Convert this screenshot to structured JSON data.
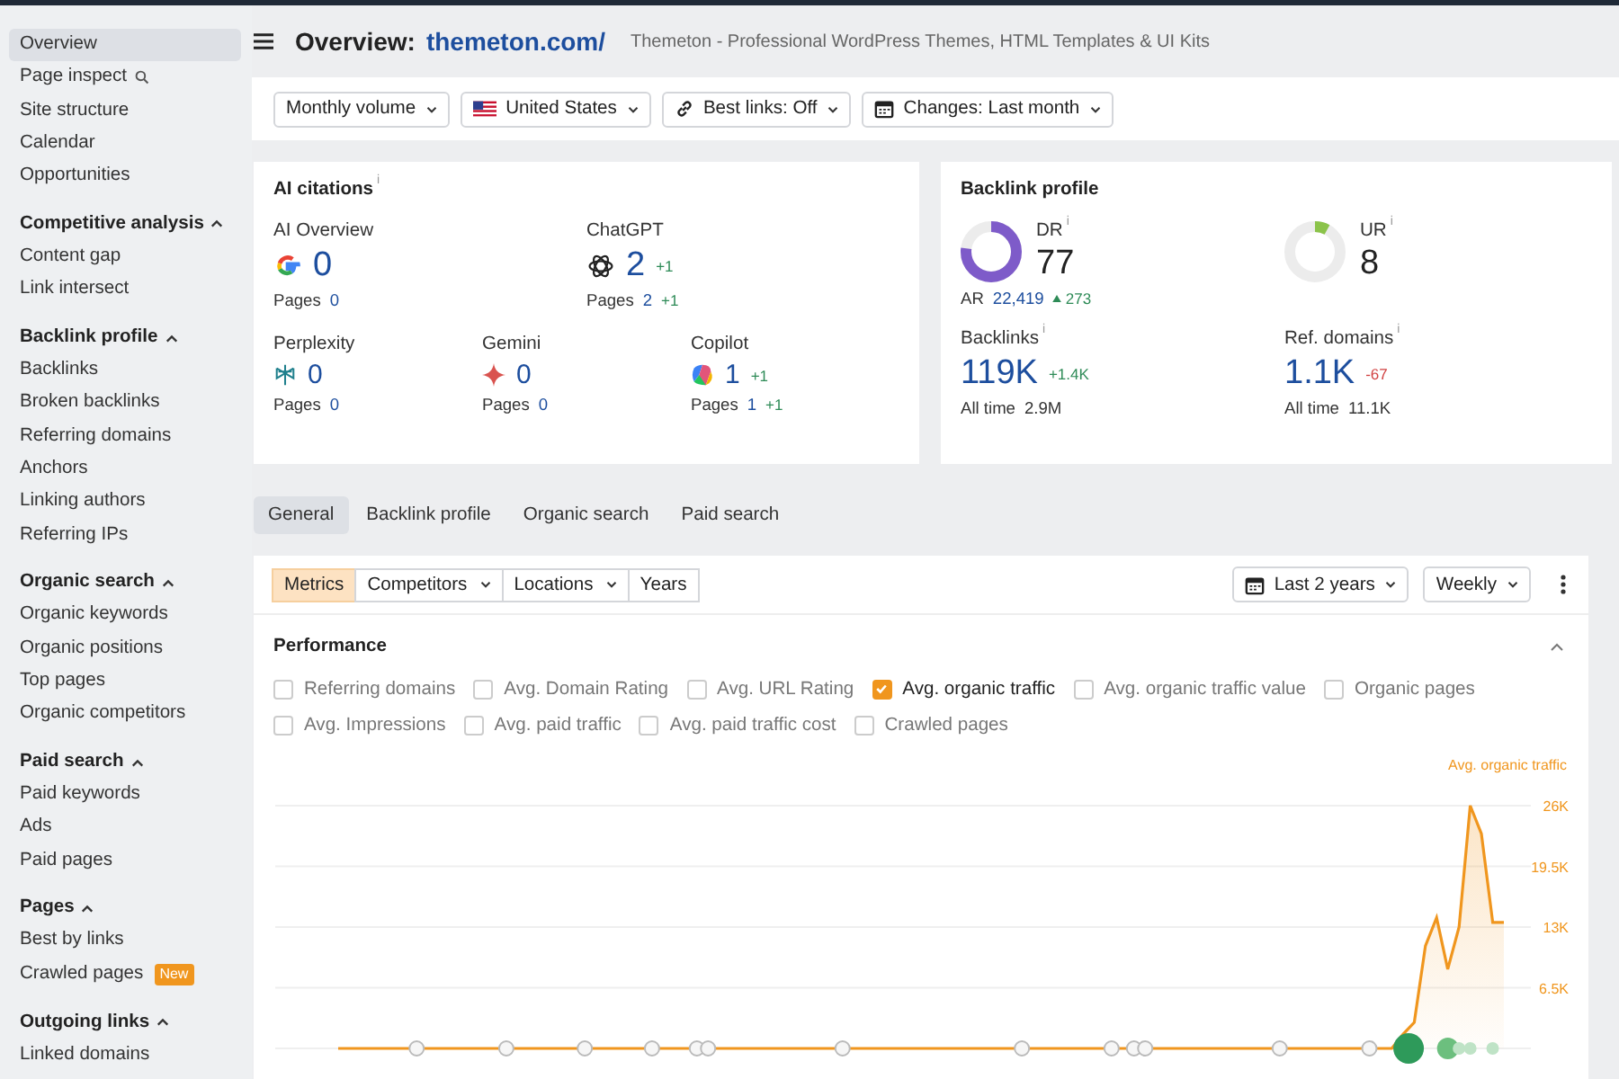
{
  "sidebar": {
    "sections": [
      {
        "items": [
          {
            "label": "Overview",
            "selected": true
          },
          {
            "label": "Page inspect",
            "selected": false,
            "search_icon": true
          },
          {
            "label": "Site structure",
            "selected": false
          },
          {
            "label": "Calendar",
            "selected": false
          },
          {
            "label": "Opportunities",
            "selected": false
          }
        ]
      },
      {
        "title": "Competitive analysis",
        "expanded": true,
        "items": [
          {
            "label": "Content gap",
            "selected": false
          },
          {
            "label": "Link intersect",
            "selected": false
          }
        ]
      },
      {
        "title": "Backlink profile",
        "expanded": true,
        "items": [
          {
            "label": "Backlinks",
            "selected": false
          },
          {
            "label": "Broken backlinks",
            "selected": false
          },
          {
            "label": "Referring domains",
            "selected": false
          },
          {
            "label": "Anchors",
            "selected": false
          },
          {
            "label": "Linking authors",
            "selected": false
          },
          {
            "label": "Referring IPs",
            "selected": false
          }
        ]
      },
      {
        "title": "Organic search",
        "expanded": true,
        "items": [
          {
            "label": "Organic keywords",
            "selected": false
          },
          {
            "label": "Organic positions",
            "selected": false
          },
          {
            "label": "Top pages",
            "selected": false
          },
          {
            "label": "Organic competitors",
            "selected": false
          }
        ]
      },
      {
        "title": "Paid search",
        "expanded": true,
        "items": [
          {
            "label": "Paid keywords",
            "selected": false
          },
          {
            "label": "Ads",
            "selected": false
          },
          {
            "label": "Paid pages",
            "selected": false
          }
        ]
      },
      {
        "title": "Pages",
        "expanded": true,
        "items": [
          {
            "label": "Best by links",
            "selected": false
          },
          {
            "label": "Crawled pages",
            "selected": false,
            "badge": "New"
          }
        ]
      },
      {
        "title": "Outgoing links",
        "expanded": true,
        "items": [
          {
            "label": "Linked domains",
            "selected": false
          }
        ]
      }
    ]
  },
  "header": {
    "title": "Overview:",
    "domain": "themeton.com/",
    "subtitle": "Themeton - Professional WordPress Themes, HTML Templates & UI Kits"
  },
  "filters": [
    {
      "kind": "plain",
      "label": "Monthly volume"
    },
    {
      "kind": "flag",
      "label": "United States"
    },
    {
      "kind": "link",
      "label": "Best links: Off"
    },
    {
      "kind": "calendar",
      "label": "Changes: Last month"
    }
  ],
  "ai_citations": {
    "title": "AI citations",
    "info": "i",
    "rows": [
      [
        {
          "name": "AI Overview",
          "kind": "google",
          "value": "0",
          "pages_label": "Pages",
          "pages": "0"
        },
        {
          "name": "ChatGPT",
          "kind": "chatgpt",
          "value": "2",
          "delta": "+1",
          "pages_label": "Pages",
          "pages": "2",
          "pages_delta": "+1"
        }
      ],
      [
        {
          "name": "Perplexity",
          "kind": "perplexity",
          "value": "0",
          "pages_label": "Pages",
          "pages": "0"
        },
        {
          "name": "Gemini",
          "kind": "gemini",
          "value": "0",
          "pages_label": "Pages",
          "pages": "0"
        },
        {
          "name": "Copilot",
          "kind": "copilot",
          "value": "1",
          "delta": "+1",
          "pages_label": "Pages",
          "pages": "1",
          "pages_delta": "+1"
        }
      ]
    ]
  },
  "backlink_profile": {
    "title": "Backlink profile",
    "ratings": [
      {
        "label": "DR",
        "info": "i",
        "value": "77",
        "level": 0.77,
        "color": "#7e5bc9",
        "ar_label": "AR",
        "ar_value": "22,419",
        "ar_delta": "273"
      },
      {
        "label": "UR",
        "info": "i",
        "value": "8",
        "level": 0.08,
        "color": "#8bc34a"
      }
    ],
    "stats": [
      {
        "label": "Backlinks",
        "info": "i",
        "value": "119K",
        "delta": "+1.4K",
        "color": "#2e8b57",
        "all_time_label": "All time",
        "all_time": "2.9M"
      },
      {
        "label": "Ref. domains",
        "info": "i",
        "value": "1.1K",
        "delta": "-67",
        "color": "#d14343",
        "all_time_label": "All time",
        "all_time": "11.1K"
      }
    ]
  },
  "tabs": [
    {
      "label": "General",
      "selected": true
    },
    {
      "label": "Backlink profile",
      "selected": false
    },
    {
      "label": "Organic search",
      "selected": false
    },
    {
      "label": "Paid search",
      "selected": false
    }
  ],
  "toolbar": {
    "segments": [
      {
        "label": "Metrics",
        "selected": true,
        "dropdown": false
      },
      {
        "label": "Competitors",
        "selected": false,
        "dropdown": true
      },
      {
        "label": "Locations",
        "selected": false,
        "dropdown": true
      },
      {
        "label": "Years",
        "selected": false,
        "dropdown": false
      }
    ],
    "period": "Last 2 years",
    "interval": "Weekly"
  },
  "performance": {
    "title": "Performance",
    "expanded": true,
    "metrics": [
      [
        {
          "label": "Referring domains",
          "checked": false
        },
        {
          "label": "Avg. Domain Rating",
          "checked": false
        },
        {
          "label": "Avg. URL Rating",
          "checked": false
        },
        {
          "label": "Avg. organic traffic",
          "checked": true
        },
        {
          "label": "Avg. organic traffic value",
          "checked": false
        },
        {
          "label": "Organic pages",
          "checked": false
        }
      ],
      [
        {
          "label": "Avg. Impressions",
          "checked": false
        },
        {
          "label": "Avg. paid traffic",
          "checked": false
        },
        {
          "label": "Avg. paid traffic cost",
          "checked": false
        },
        {
          "label": "Crawled pages",
          "checked": false
        }
      ]
    ],
    "chart_data": {
      "type": "area",
      "grid": true,
      "ylim": [
        0,
        26000
      ],
      "yticks": [
        {
          "value": 6500,
          "label": "6.5K"
        },
        {
          "value": 13000,
          "label": "13K"
        },
        {
          "value": 19500,
          "label": "19.5K"
        },
        {
          "value": 26000,
          "label": "26K"
        }
      ],
      "series": [
        {
          "name": "Avg. organic traffic",
          "color": "#f0961e",
          "values": [
            0,
            0,
            0,
            0,
            0,
            0,
            0,
            0,
            0,
            0,
            0,
            0,
            0,
            0,
            0,
            0,
            0,
            0,
            0,
            0,
            0,
            0,
            0,
            0,
            0,
            0,
            0,
            0,
            0,
            0,
            0,
            0,
            0,
            0,
            0,
            0,
            0,
            0,
            0,
            0,
            0,
            0,
            0,
            0,
            0,
            0,
            0,
            0,
            0,
            0,
            0,
            0,
            0,
            0,
            0,
            0,
            0,
            0,
            0,
            0,
            0,
            0,
            0,
            0,
            0,
            0,
            0,
            0,
            0,
            0,
            0,
            0,
            0,
            0,
            0,
            0,
            0,
            0,
            0,
            0,
            0,
            0,
            0,
            0,
            0,
            0,
            0,
            0,
            0,
            0,
            0,
            0,
            0,
            0,
            0,
            1500,
            2800,
            11000,
            14000,
            8500,
            13000,
            26000,
            23000,
            13500,
            13500
          ]
        }
      ]
    }
  }
}
